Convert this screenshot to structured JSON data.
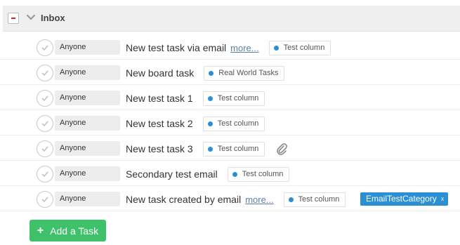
{
  "section": {
    "title": "Inbox"
  },
  "tasks": [
    {
      "assignee": "Anyone",
      "title": "New test task via email",
      "more": "more...",
      "column": "Test column"
    },
    {
      "assignee": "Anyone",
      "title": "New board task",
      "column": "Real World Tasks"
    },
    {
      "assignee": "Anyone",
      "title": "New test task 1",
      "column": "Test column"
    },
    {
      "assignee": "Anyone",
      "title": "New test task 2",
      "column": "Test column"
    },
    {
      "assignee": "Anyone",
      "title": "New test task 3",
      "column": "Test column",
      "attachment_icon": "paperclip-icon"
    },
    {
      "assignee": "Anyone",
      "title": "Secondary test email",
      "column": "Test column"
    },
    {
      "assignee": "Anyone",
      "title": "New task created by email",
      "more": "more...",
      "column": "Test column",
      "category": "EmailTestCategory",
      "category_remove": "x"
    }
  ],
  "add_task": {
    "label": "Add a Task",
    "icon": "+"
  },
  "colors": {
    "accent": "#2a8fd4",
    "add_button": "#3fc16a",
    "collapse": "#c62828"
  }
}
